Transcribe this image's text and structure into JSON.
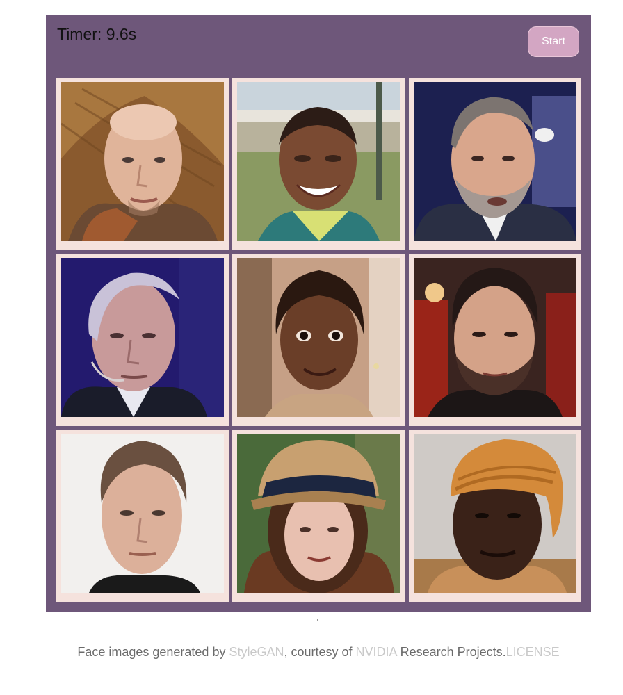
{
  "header": {
    "timer_label": "Timer: 9.6s",
    "start_label": "Start"
  },
  "colors": {
    "board": "#6e577a",
    "tile_frame": "#f5e2dd",
    "start_button": "#d3a6c3",
    "footer_text": "#6b6b6b",
    "footer_link": "#c9c9c9"
  },
  "grid": {
    "tiles": [
      {
        "icon": "face-photo-icon",
        "subject": "bald man with hat"
      },
      {
        "icon": "face-photo-icon",
        "subject": "smiling person outdoors"
      },
      {
        "icon": "face-photo-icon",
        "subject": "bearded man in suit"
      },
      {
        "icon": "face-photo-icon",
        "subject": "older man with headset mic"
      },
      {
        "icon": "face-photo-icon",
        "subject": "smiling girl with braids"
      },
      {
        "icon": "face-photo-icon",
        "subject": "young bearded man"
      },
      {
        "icon": "face-photo-icon",
        "subject": "middle-aged man on white background"
      },
      {
        "icon": "face-photo-icon",
        "subject": "woman wearing bucket hat"
      },
      {
        "icon": "face-photo-icon",
        "subject": "man wearing orange head wrap"
      }
    ]
  },
  "footer": {
    "prefix": "Face images generated by ",
    "stylegan_link": "StyleGAN",
    "middle": ", courtesy of ",
    "nvidia_link": "NVIDIA",
    "suffix": " Research Projects.",
    "license_link": "LICENSE"
  }
}
